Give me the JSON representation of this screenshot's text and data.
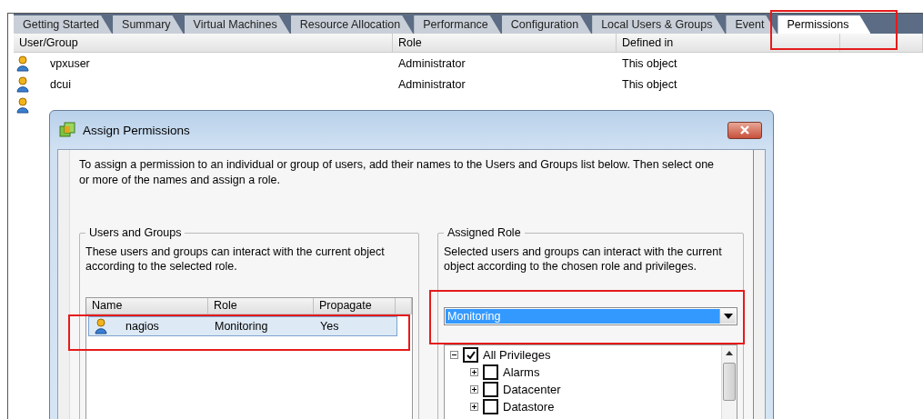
{
  "tabs": [
    {
      "label": "Getting Started",
      "selected": false
    },
    {
      "label": "Summary",
      "selected": false
    },
    {
      "label": "Virtual Machines",
      "selected": false
    },
    {
      "label": "Resource Allocation",
      "selected": false
    },
    {
      "label": "Performance",
      "selected": false
    },
    {
      "label": "Configuration",
      "selected": false
    },
    {
      "label": "Local Users & Groups",
      "selected": false
    },
    {
      "label": "Event",
      "selected": false
    },
    {
      "label": "Permissions",
      "selected": true,
      "highlighted": true
    }
  ],
  "table": {
    "columns": [
      "User/Group",
      "Role",
      "Defined in"
    ],
    "rows": [
      {
        "kind": "user",
        "user": "vpxuser",
        "role": "Administrator",
        "defined_in": "This object"
      },
      {
        "kind": "user",
        "user": "dcui",
        "role": "Administrator",
        "defined_in": "This object"
      },
      {
        "kind": "user"
      }
    ]
  },
  "dialog": {
    "title": "Assign Permissions",
    "intro": "To assign a permission to an individual or group of users, add their names to the Users and Groups list below. Then select one or more of the names and assign a role.",
    "users_group": {
      "title": "Users and Groups",
      "description": "These users and groups can interact with the current object according to the selected role.",
      "columns": [
        "Name",
        "Role",
        "Propagate"
      ],
      "rows": [
        {
          "name": "nagios",
          "role": "Monitoring",
          "propagate": "Yes",
          "selected": true,
          "highlighted": true
        }
      ]
    },
    "role_group": {
      "title": "Assigned Role",
      "description": "Selected users and groups can interact with the current object according to the chosen role and privileges.",
      "role": {
        "value": "Monitoring",
        "highlighted": true
      },
      "privileges": [
        {
          "label": "All Privileges",
          "checked": true,
          "expanded": true,
          "children": [
            {
              "label": "Alarms",
              "checked": false,
              "expanded": false
            },
            {
              "label": "Datacenter",
              "checked": false,
              "expanded": false
            },
            {
              "label": "Datastore",
              "checked": false,
              "expanded": false
            }
          ]
        }
      ]
    }
  }
}
